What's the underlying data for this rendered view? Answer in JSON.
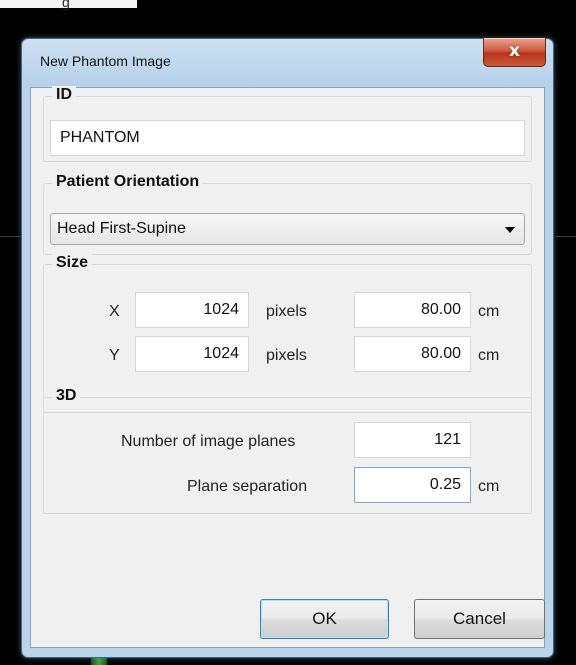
{
  "background": {
    "partial_label": "g"
  },
  "window": {
    "title": "New Phantom Image",
    "close_label": "x"
  },
  "id_group": {
    "label": "ID",
    "value": "PHANTOM"
  },
  "orientation_group": {
    "label": "Patient Orientation",
    "selected": "Head First-Supine"
  },
  "size_group": {
    "label": "Size",
    "x_label": "X",
    "x_pixels": "1024",
    "x_unit": "pixels",
    "x_cm": "80.00",
    "y_label": "Y",
    "y_pixels": "1024",
    "y_unit": "pixels",
    "y_cm": "80.00",
    "cm_unit": "cm"
  },
  "threed_group": {
    "label": "3D",
    "planes_label": "Number of image planes",
    "planes_value": "121",
    "separation_label": "Plane separation",
    "separation_value": "0.25",
    "separation_unit": "cm"
  },
  "buttons": {
    "ok": "OK",
    "cancel": "Cancel"
  }
}
